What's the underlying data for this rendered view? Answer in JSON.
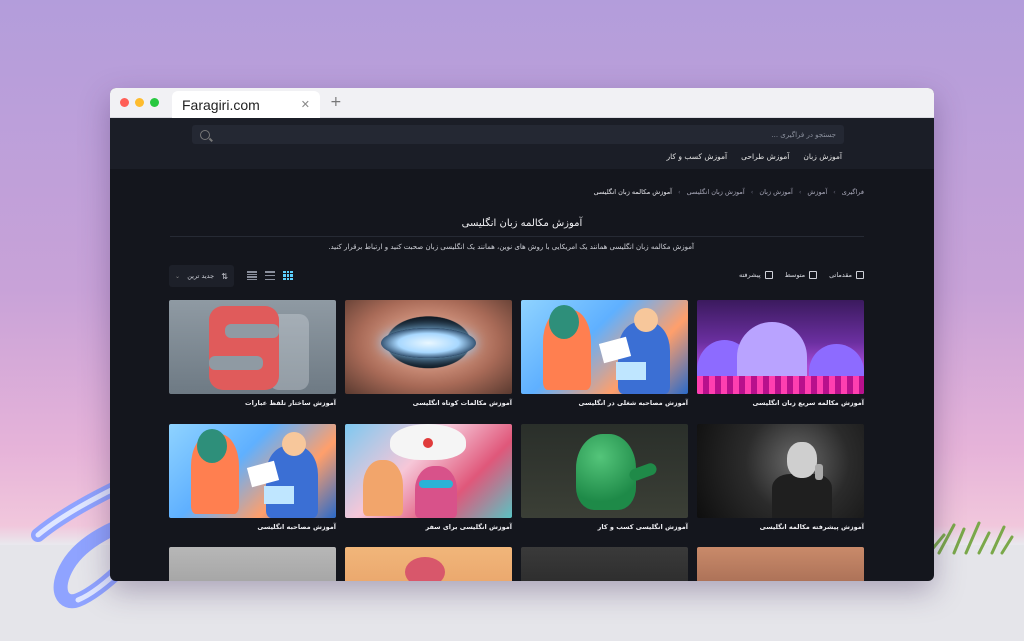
{
  "browser": {
    "tab_title": "Faragiri.com",
    "close": "✕",
    "new_tab": "+"
  },
  "header": {
    "search_placeholder": "جستجو در فراگیری ...",
    "nav": [
      "آموزش زبان",
      "آموزش طراحی",
      "آموزش کسب و کار"
    ]
  },
  "breadcrumb": {
    "items": [
      "فراگیری",
      "آموزش",
      "آموزش زبان",
      "آموزش زبان انگلیسی",
      "آموزش مکالمه زبان انگلیسی"
    ],
    "separator": "›"
  },
  "page": {
    "title": "آموزش مکالمه زبان انگلیسی",
    "description": "آموزش مکالمه زبان انگلیسی همانند یک امریکایی با روش های نوین، همانند یک انگلیسی زبان صحبت کنید و ارتباط برقرار کنید."
  },
  "filters": {
    "levels": [
      "مقدماتی",
      "متوسط",
      "پیشرفته"
    ]
  },
  "sort": {
    "label": "جدید ترین",
    "icon": "sort-icon"
  },
  "views": [
    "grid-view-icon",
    "list-view-icon",
    "compact-view-icon"
  ],
  "cards": [
    {
      "title": "آموزش مکالمه سریع زبان انگلیسی",
      "thumb": "purple-mountains"
    },
    {
      "title": "آموزش مصاحبه شغلی در انگلیسی",
      "thumb": "people-conversation"
    },
    {
      "title": "آموزش مکالمات کوتاه انگلیسی",
      "thumb": "glowing-mouth"
    },
    {
      "title": "آموزش ساختار تلفظ عبارات",
      "thumb": "letter-s"
    },
    {
      "title": "آموزش پیشرفته مکالمه انگلیسی",
      "thumb": "singer-bw"
    },
    {
      "title": "آموزش انگلیسی کسب و کار",
      "thumb": "green-blob"
    },
    {
      "title": "آموزش انگلیسی برای سفر",
      "thumb": "circus-illustration"
    },
    {
      "title": "آموزش مصاحبه انگلیسی",
      "thumb": "people-conversation"
    }
  ],
  "colors": {
    "accent": "#5dd1ff",
    "background": "#14161d"
  }
}
